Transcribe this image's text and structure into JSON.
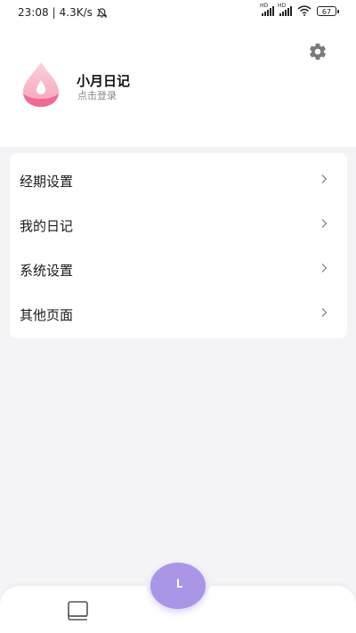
{
  "status_bar": {
    "time": "23:08",
    "separator": "|",
    "network_speed": "4.3K/s",
    "signal_label_1": "HD",
    "signal_label_2": "HD",
    "battery": "67"
  },
  "header": {
    "settings_icon": "gear-icon"
  },
  "profile": {
    "app_name": "小月日记",
    "login_text": "点击登录",
    "logo_icon": "droplet-logo"
  },
  "menu": {
    "items": [
      {
        "label": "经期设置",
        "icon": "chevron-right-icon"
      },
      {
        "label": "我的日记",
        "icon": "chevron-right-icon"
      },
      {
        "label": "系统设置",
        "icon": "chevron-right-icon"
      },
      {
        "label": "其他页面",
        "icon": "chevron-right-icon"
      }
    ]
  },
  "bottom_nav": {
    "left_icon": "book-icon",
    "center_icon": "clock-icon"
  },
  "colors": {
    "accent_purple": "#a996e6",
    "logo_pink": "#f06a94",
    "background": "#f4f4f6"
  }
}
